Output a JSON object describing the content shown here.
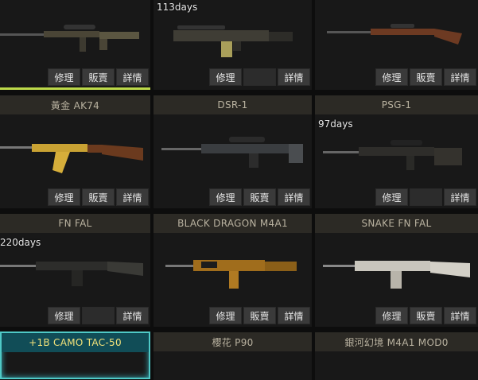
{
  "labels": {
    "repair": "修理",
    "sell": "販賣",
    "detail": "詳情"
  },
  "cards": [
    {
      "id": "r1c1",
      "title": "",
      "days": ""
    },
    {
      "id": "r1c2",
      "title": "",
      "days": "113days"
    },
    {
      "id": "r1c3",
      "title": "",
      "days": ""
    },
    {
      "id": "r2c1",
      "title": "黃金 AK74",
      "days": ""
    },
    {
      "id": "r2c2",
      "title": "DSR-1",
      "days": ""
    },
    {
      "id": "r2c3",
      "title": "PSG-1",
      "days": "97days"
    },
    {
      "id": "r3c1",
      "title": "FN FAL",
      "days": "220days"
    },
    {
      "id": "r3c2",
      "title": "BLACK DRAGON M4A1",
      "days": ""
    },
    {
      "id": "r3c3",
      "title": "SNAKE FN FAL",
      "days": ""
    },
    {
      "id": "r4c1",
      "title": "+1B CAMO TAC-50",
      "days": ""
    },
    {
      "id": "r4c2",
      "title": "櫻花 P90",
      "days": ""
    },
    {
      "id": "r4c3",
      "title": "銀河幻境 M4A1 MOD0",
      "days": ""
    }
  ],
  "colors": {
    "selected_accent": "#bcd94a",
    "highlight_border": "#4fc9c6",
    "highlight_title_text": "#f2e27a"
  }
}
